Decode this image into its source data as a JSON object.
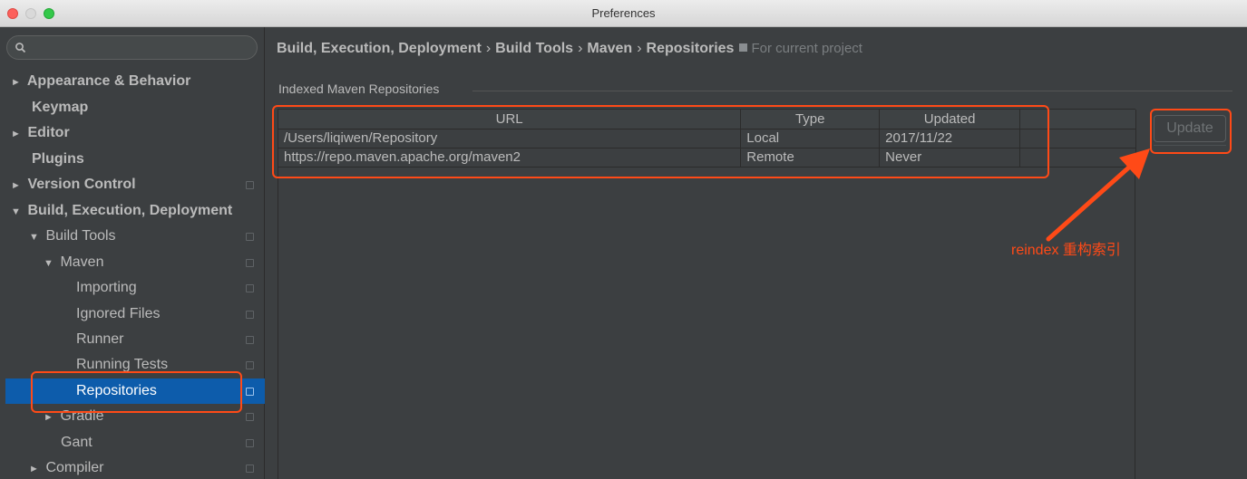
{
  "window": {
    "title": "Preferences"
  },
  "sidebar": {
    "search_placeholder": "",
    "items": [
      {
        "label": "Appearance & Behavior",
        "arrow": "►"
      },
      {
        "label": "Keymap",
        "arrow": ""
      },
      {
        "label": "Editor",
        "arrow": "►"
      },
      {
        "label": "Plugins",
        "arrow": ""
      },
      {
        "label": "Version Control",
        "arrow": "►"
      },
      {
        "label": "Build, Execution, Deployment",
        "arrow": "▼"
      },
      {
        "label": "Build Tools",
        "arrow": "▼"
      },
      {
        "label": "Maven",
        "arrow": "▼"
      },
      {
        "label": "Importing",
        "arrow": ""
      },
      {
        "label": "Ignored Files",
        "arrow": ""
      },
      {
        "label": "Runner",
        "arrow": ""
      },
      {
        "label": "Running Tests",
        "arrow": ""
      },
      {
        "label": "Repositories",
        "arrow": ""
      },
      {
        "label": "Gradle",
        "arrow": "►"
      },
      {
        "label": "Gant",
        "arrow": ""
      },
      {
        "label": "Compiler",
        "arrow": "►"
      }
    ]
  },
  "breadcrumb": {
    "parts": [
      "Build, Execution, Deployment",
      "Build Tools",
      "Maven",
      "Repositories"
    ],
    "separator": "›",
    "scope": "For current project"
  },
  "group": {
    "label": "Indexed Maven Repositories"
  },
  "table": {
    "columns": [
      "URL",
      "Type",
      "Updated"
    ],
    "rows": [
      [
        "/Users/liqiwen/Repository",
        "Local",
        "2017/11/22"
      ],
      [
        "https://repo.maven.apache.org/maven2",
        "Remote",
        "Never"
      ]
    ]
  },
  "buttons": {
    "update": "Update"
  },
  "annotation": {
    "text": "reindex 重构索引",
    "color": "#ff4a17"
  }
}
